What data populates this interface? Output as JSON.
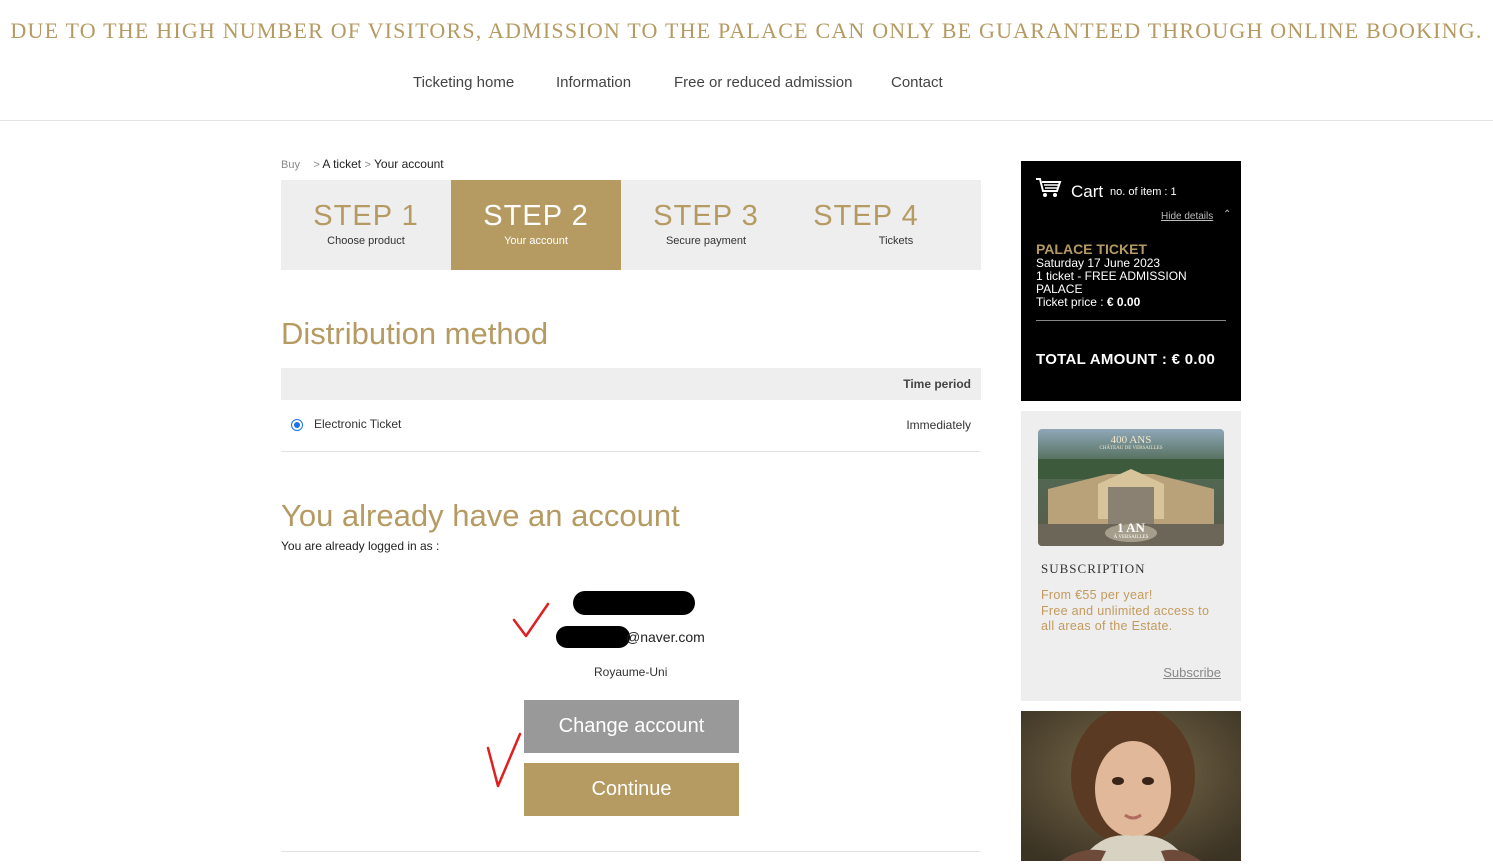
{
  "banner": "DUE TO THE HIGH NUMBER OF VISITORS, ADMISSION TO THE PALACE CAN ONLY BE GUARANTEED THROUGH ONLINE BOOKING.",
  "nav": [
    "Ticketing home",
    "Information",
    "Free or reduced admission",
    "Contact"
  ],
  "breadcrumb": {
    "buy": "Buy",
    "sep1": ">",
    "ticket": "A ticket",
    "sep2": ">",
    "account": "Your account"
  },
  "steps": [
    {
      "num": "STEP 1",
      "label": "Choose product"
    },
    {
      "num": "STEP 2",
      "label": "Your account"
    },
    {
      "num": "STEP 3",
      "label": "Secure payment"
    },
    {
      "num": "STEP 4",
      "label": "Tickets"
    }
  ],
  "active_step": 2,
  "distribution": {
    "title": "Distribution method",
    "column_header": "Time period",
    "option_label": "Electronic Ticket",
    "option_period": "Immediately",
    "option_selected": true
  },
  "account": {
    "title": "You already have an account",
    "logged_in_text": "You are already logged in as :",
    "email_suffix": "@naver.com",
    "country": "Royaume-Uni"
  },
  "buttons": {
    "change_account": "Change account",
    "continue": "Continue"
  },
  "cart": {
    "title": "Cart",
    "count_label": "no. of item : 1",
    "hide_details": "Hide details",
    "product": "PALACE TICKET",
    "date": "Saturday 17 June 2023",
    "ticket_line": "1 ticket - FREE ADMISSION",
    "ticket_line2": "PALACE",
    "price_label": "Ticket price : ",
    "price": "€ 0.00",
    "total": "TOTAL AMOUNT : € 0.00"
  },
  "subscription": {
    "image_top": "400 ANS",
    "image_sub": "CHÂTEAU DE VERSAILLES",
    "image_badge": "1 AN",
    "image_badge_sub": "À VERSAILLES",
    "title": "SUBSCRIPTION",
    "line1": "From €55 per year!",
    "line2": "Free and unlimited access to",
    "line3": "all areas of the Estate.",
    "link": "Subscribe"
  },
  "colors": {
    "gold": "#b59a62",
    "step_bg": "#eeeeee",
    "cart_bg": "#000000",
    "grey_button": "#999999",
    "check_red": "#e02020"
  }
}
